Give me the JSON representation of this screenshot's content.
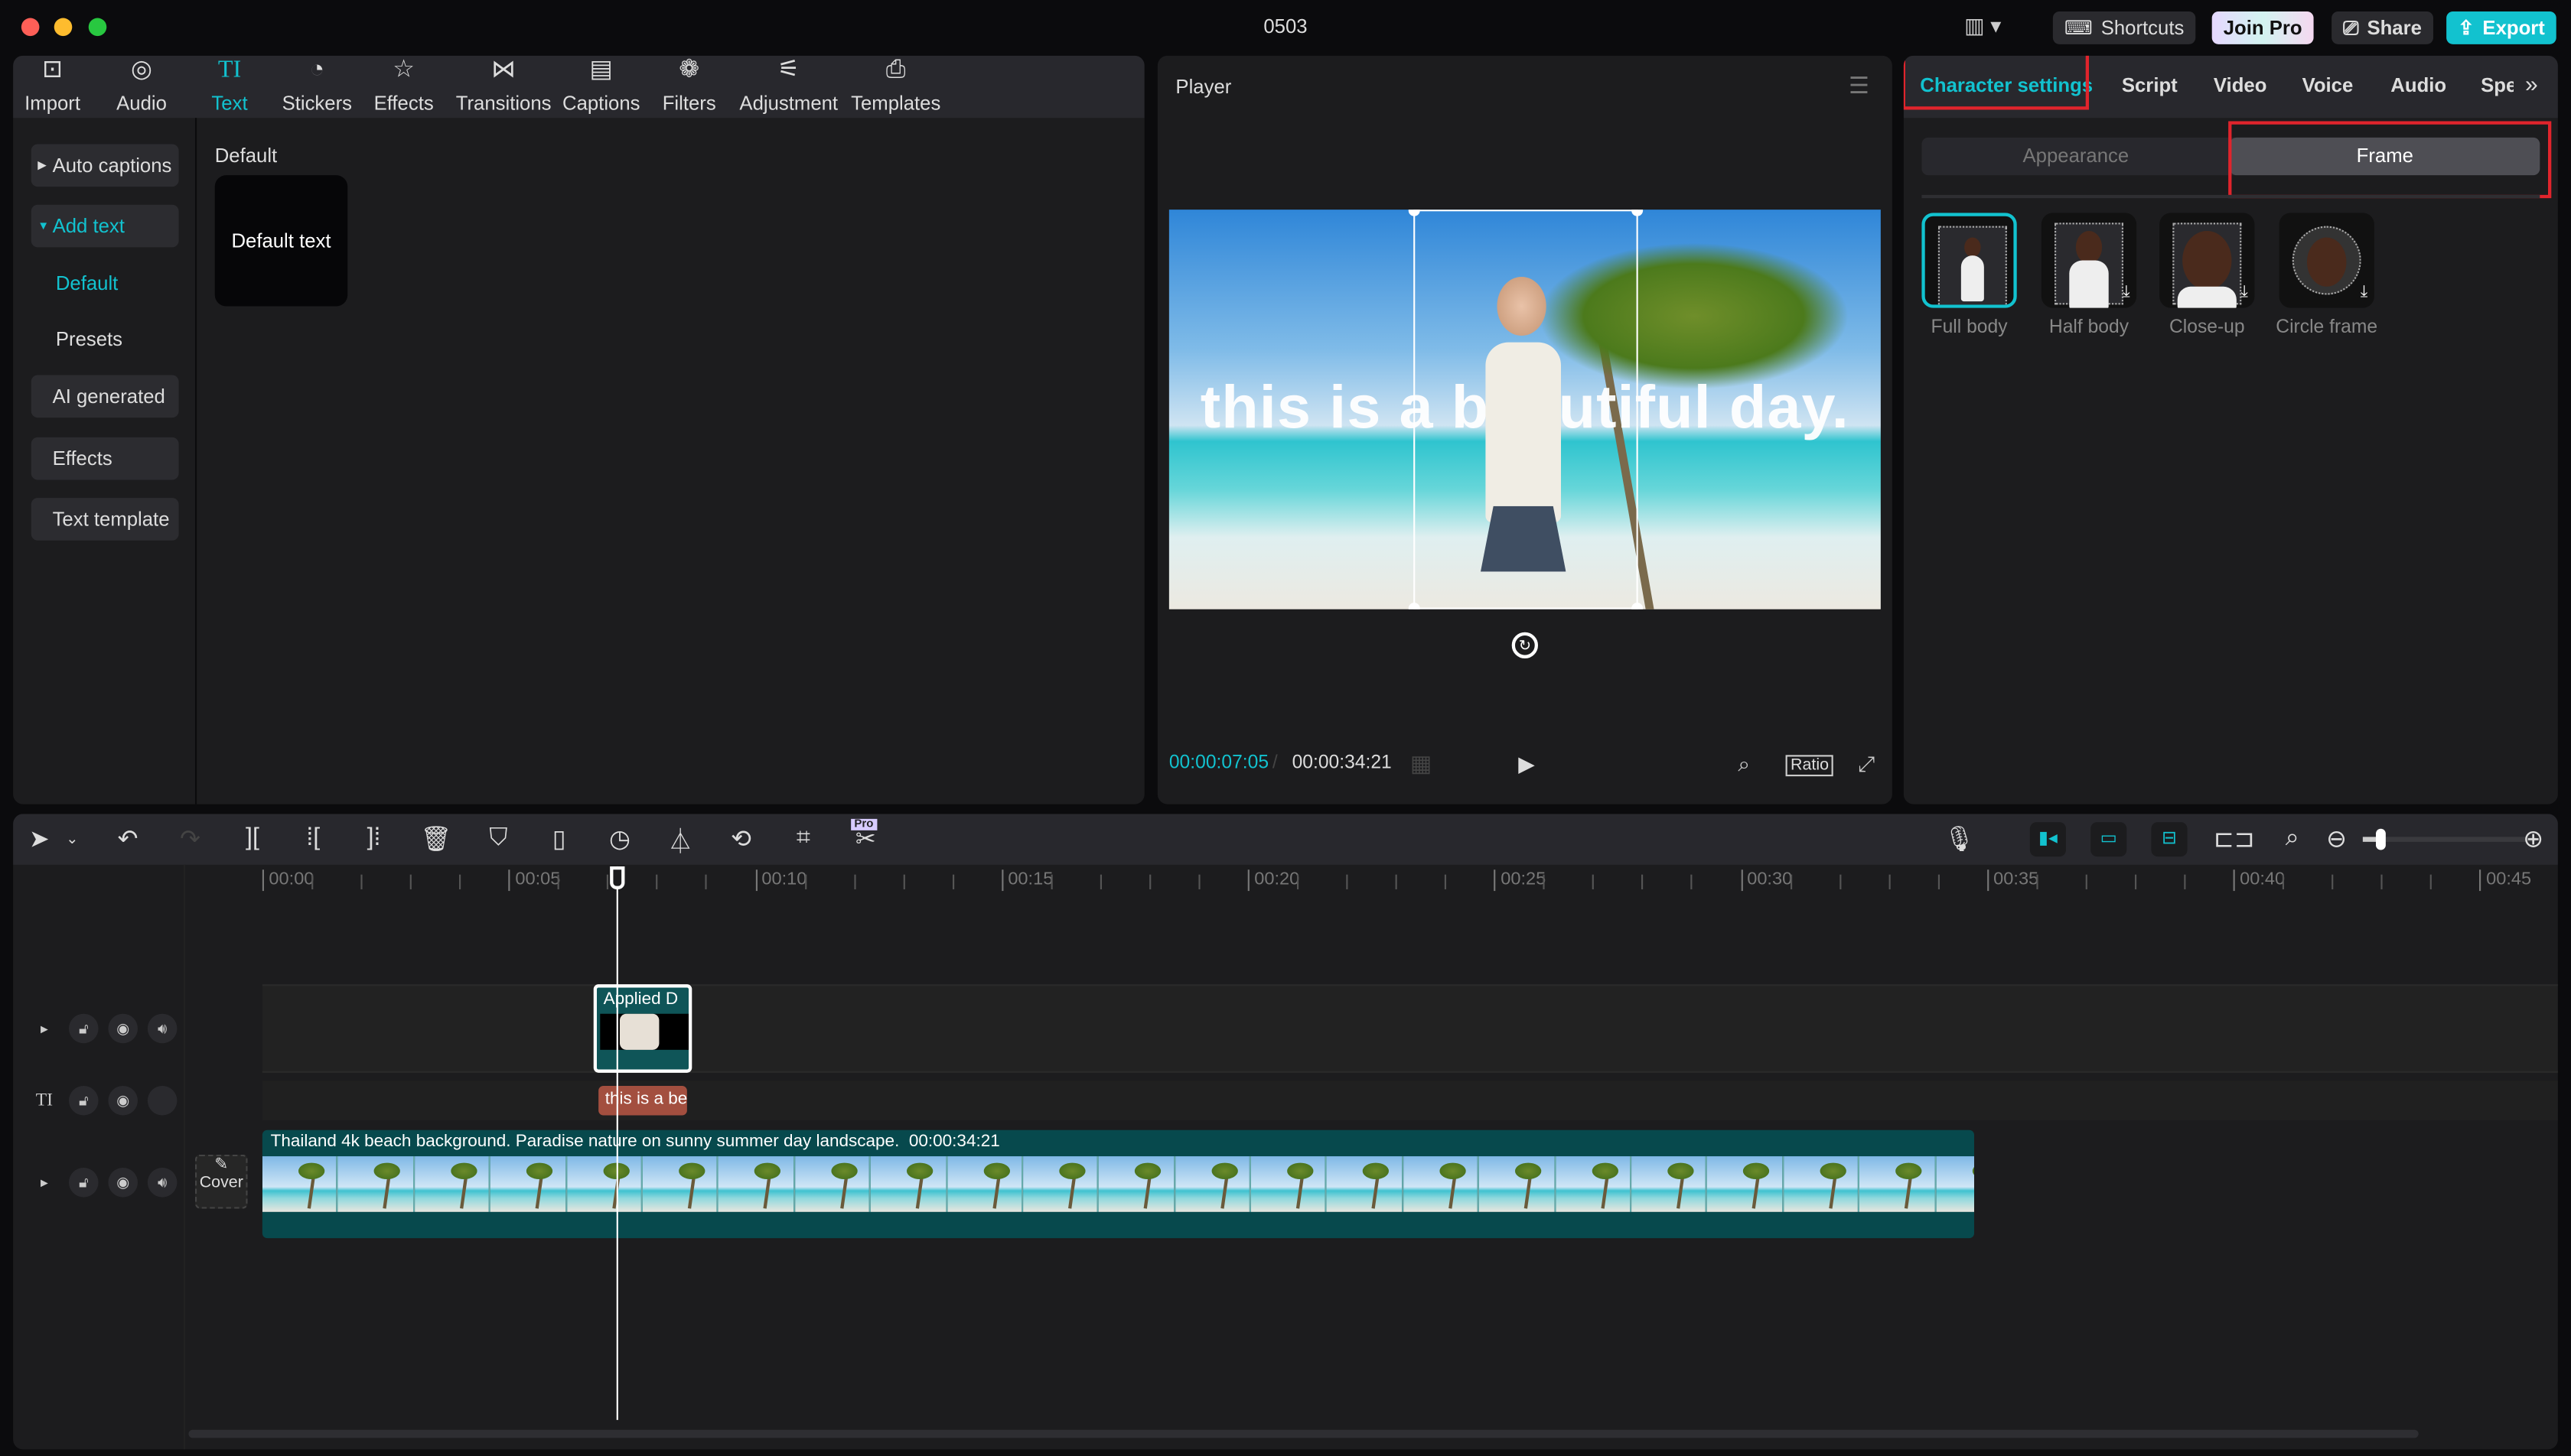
{
  "window": {
    "title": "0503"
  },
  "topbar": {
    "shortcuts": "Shortcuts",
    "join_pro": "Join Pro",
    "share": "Share",
    "export": "Export",
    "accent": "#12c2cf"
  },
  "toolbar": {
    "items": [
      {
        "label": "Import",
        "icon": "import-icon"
      },
      {
        "label": "Audio",
        "icon": "audio-icon"
      },
      {
        "label": "Text",
        "icon": "text-icon"
      },
      {
        "label": "Stickers",
        "icon": "sticker-icon"
      },
      {
        "label": "Effects",
        "icon": "effects-icon"
      },
      {
        "label": "Transitions",
        "icon": "transitions-icon"
      },
      {
        "label": "Captions",
        "icon": "captions-icon"
      },
      {
        "label": "Filters",
        "icon": "filters-icon"
      },
      {
        "label": "Adjustment",
        "icon": "adjustment-icon"
      },
      {
        "label": "Templates",
        "icon": "templates-icon"
      }
    ],
    "active": "Text"
  },
  "sidebar": {
    "items": [
      "Auto captions",
      "Add text",
      "Default",
      "Presets",
      "AI generated",
      "Effects",
      "Text template"
    ]
  },
  "content": {
    "section": "Default",
    "card": "Default text"
  },
  "player": {
    "title": "Player",
    "overlay_text": "this is a beautiful day.",
    "current_time": "00:00:07:05",
    "total_time": "00:00:34:21",
    "ratio": "Ratio"
  },
  "right": {
    "tabs": [
      "Character settings",
      "Script",
      "Video",
      "Voice",
      "Audio",
      "Speed"
    ],
    "active_tab": "Character settings",
    "subtabs": [
      "Appearance",
      "Frame"
    ],
    "active_subtab": "Frame",
    "frames": [
      "Full body",
      "Half body",
      "Close-up",
      "Circle frame"
    ],
    "selected_frame": "Full body"
  },
  "timeline": {
    "ticks": [
      "00:00",
      "00:05",
      "00:10",
      "00:15",
      "00:20",
      "00:25",
      "00:30",
      "00:35",
      "00:40",
      "00:45"
    ],
    "pro_badge": "Pro",
    "playhead_seconds": 7.2,
    "zoom_level": 0.1,
    "avatar_clip": {
      "label": "Applied",
      "label2": "D"
    },
    "text_clip": "this is a be",
    "main_clip": {
      "title": "Thailand 4k beach background. Paradise nature on sunny summer day landscape.",
      "duration": "00:00:34:21"
    },
    "cover": "Cover"
  }
}
